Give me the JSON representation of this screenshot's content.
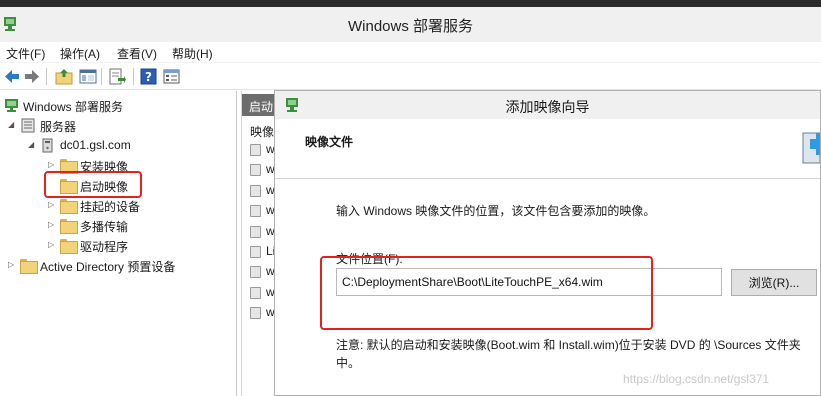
{
  "window": {
    "title": "Windows 部署服务"
  },
  "menu": [
    "文件(F)",
    "操作(A)",
    "查看(V)",
    "帮助(H)"
  ],
  "toolbar": {
    "icons": [
      "back-arrow-icon",
      "forward-arrow-icon",
      "up-folder-icon",
      "show-hide-tree-icon",
      "export-list-icon",
      "help-icon",
      "properties-icon"
    ]
  },
  "tree": {
    "root": "Windows 部署服务",
    "servers": "服务器",
    "server": "dc01.gsl.com",
    "install_images": "安装映像",
    "boot_images": "启动映像",
    "pending_devices": "挂起的设备",
    "multicast": "多播传输",
    "drivers": "驱动程序",
    "active_directory": "Active Directory 预置设备"
  },
  "middle": {
    "header": "启动",
    "column": "映像",
    "rows": [
      "wi",
      "wi",
      "wi",
      "wi",
      "wi",
      "Lit",
      "wi",
      "wi",
      "wi"
    ]
  },
  "dialog": {
    "title": "添加映像向导",
    "heading": "映像文件",
    "intro": "输入 Windows 映像文件的位置，该文件包含要添加的映像。",
    "location_label": "文件位置(F):",
    "path_value": "C:\\DeploymentShare\\Boot\\LiteTouchPE_x64.wim",
    "browse_label": "浏览(R)...",
    "note": "注意: 默认的启动和安装映像(Boot.wim 和 Install.wim)位于安装 DVD 的 \\Sources 文件夹中。"
  },
  "watermark": "https://blog.csdn.net/gsl371",
  "colors": {
    "highlight": "#e3231b",
    "titlebar": "#f0f0f0",
    "panel_header": "#6d6d6d"
  }
}
